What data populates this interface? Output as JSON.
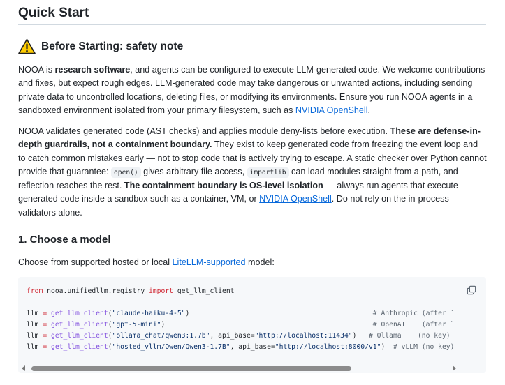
{
  "title": "Quick Start",
  "warning": {
    "heading": "Before Starting: safety note"
  },
  "para1": {
    "t1": "NOOA is ",
    "b1": "research software",
    "t2": ", and agents can be configured to execute LLM-generated code. We welcome contributions and fixes, but expect rough edges. LLM-generated code may take dangerous or unwanted actions, including sending private data to uncontrolled locations, deleting files, or modifying its environments. Ensure you run NOOA agents in a sandboxed environment isolated from your primary filesystem, such as ",
    "link": "NVIDIA OpenShell",
    "t3": "."
  },
  "para2": {
    "t1": "NOOA validates generated code (AST checks) and applies module deny-lists before execution. ",
    "b1": "These are defense-in-depth guardrails, not a containment boundary.",
    "t2": " They exist to keep generated code from freezing the event loop and to catch common mistakes early — not to stop code that is actively trying to escape. A static checker over Python cannot provide that guarantee: ",
    "c1": "open()",
    "t3": " gives arbitrary file access, ",
    "c2": "importlib",
    "t4": " can load modules straight from a path, and reflection reaches the rest. ",
    "b2": "The containment boundary is OS-level isolation",
    "t5": " — always run agents that execute generated code inside a sandbox such as a container, VM, or ",
    "link": "NVIDIA OpenShell",
    "t6": ". Do not rely on the in-process validators alone."
  },
  "section1": {
    "heading": "1. Choose a model",
    "intro_t1": "Choose from supported hosted or local ",
    "intro_link": "LiteLLM-supported",
    "intro_t2": " model:"
  },
  "code": {
    "from_kw": "from",
    "module": " nooa.unifiedllm.registry ",
    "import_kw": "import",
    "name": " get_llm_client",
    "lines": [
      {
        "var": "llm",
        "eq": " = ",
        "fn": "get_llm_client",
        "open": "(",
        "arg": "\"claude-haiku-4-5\"",
        "rest": ")",
        "pad": "                                             ",
        "comment": "# Anthropic (after `"
      },
      {
        "var": "llm",
        "eq": " = ",
        "fn": "get_llm_client",
        "open": "(",
        "arg": "\"gpt-5-mini\"",
        "rest": ")",
        "pad": "                                                   ",
        "comment": "# OpenAI    (after `"
      },
      {
        "var": "llm",
        "eq": " = ",
        "fn": "get_llm_client",
        "open": "(",
        "arg": "\"ollama_chat/qwen3:1.7b\"",
        "rest": ", api_base=",
        "arg2": "\"http://localhost:11434\"",
        "close": ")",
        "pad": "   ",
        "comment": "# Ollama    (no key)"
      },
      {
        "var": "llm",
        "eq": " = ",
        "fn": "get_llm_client",
        "open": "(",
        "arg": "\"hosted_vllm/Qwen/Qwen3-1.7B\"",
        "rest": ", api_base=",
        "arg2": "\"http://localhost:8000/v1\"",
        "close": ")",
        "pad": "  ",
        "comment": "# vLLM (no key)"
      }
    ]
  }
}
